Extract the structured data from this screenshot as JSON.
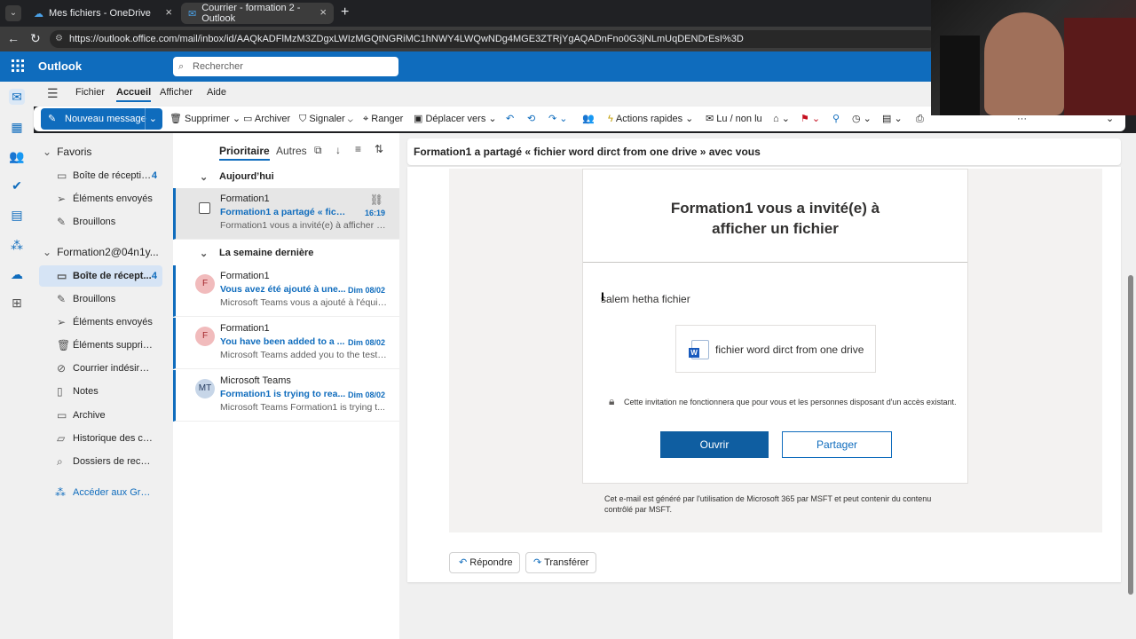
{
  "browser": {
    "tabs": [
      {
        "label": "Mes fichiers - OneDrive"
      },
      {
        "label": "Courrier - formation 2 - Outlook"
      }
    ],
    "url": "https://outlook.office.com/mail/inbox/id/AAQkADFlMzM3ZDgxLWIzMGQtNGRiMC1hNWY4LWQwNDg4MGE3ZTRjYgAQADnFno0G3jNLmUqDENDrEsI%3D"
  },
  "app": {
    "name": "Outlook",
    "search_placeholder": "Rechercher",
    "accent": "#0f6cbd"
  },
  "ribbon_tabs": [
    "Fichier",
    "Accueil",
    "Afficher",
    "Aide"
  ],
  "toolbar": {
    "new_message": "Nouveau message",
    "delete": "Supprimer",
    "archive": "Archiver",
    "report": "Signaler",
    "sweep": "Ranger",
    "move": "Déplacer vers",
    "quick_actions": "Actions rapides",
    "read_unread": "Lu / non lu"
  },
  "folders": {
    "favorites_label": "Favoris",
    "favorites": [
      {
        "label": "Boîte de réceptio...",
        "count": "4",
        "icon": "inbox-icon"
      },
      {
        "label": "Éléments envoyés",
        "icon": "send-icon"
      },
      {
        "label": "Brouillons",
        "icon": "pencil-icon"
      }
    ],
    "account_label": "Formation2@04n1y...",
    "account_items": [
      {
        "label": "Boîte de récept...",
        "count": "4",
        "icon": "inbox-icon"
      },
      {
        "label": "Brouillons",
        "icon": "pencil-icon"
      },
      {
        "label": "Éléments envoyés",
        "icon": "send-icon"
      },
      {
        "label": "Éléments supprimés",
        "icon": "trash-icon"
      },
      {
        "label": "Courrier indésirable",
        "icon": "junk-icon"
      },
      {
        "label": "Notes",
        "icon": "note-icon"
      },
      {
        "label": "Archive",
        "icon": "archive-icon"
      },
      {
        "label": "Historique des con...",
        "icon": "folder-icon"
      },
      {
        "label": "Dossiers de recher...",
        "icon": "search-folder-icon"
      }
    ],
    "groups_link": "Accéder aux Group..."
  },
  "message_list": {
    "tab_focused": "Prioritaire",
    "tab_other": "Autres",
    "group_today": "Aujourd’hui",
    "group_last_week": "La semaine dernière",
    "messages": [
      {
        "sender": "Formation1",
        "subject": "Formation1 a partagé « fichier ...",
        "preview": "Formation1 vous a invité(e) à afficher u...",
        "date": "16:19",
        "avatar": ""
      },
      {
        "sender": "Formation1",
        "subject": "Vous avez été ajouté à une...",
        "preview": "Microsoft Teams vous a ajouté à l'équip...",
        "date": "Dim 08/02",
        "avatar": "F"
      },
      {
        "sender": "Formation1",
        "subject": "You have been added to a ...",
        "preview": "Microsoft Teams added you to the test ...",
        "date": "Dim 08/02",
        "avatar": "F"
      },
      {
        "sender": "Microsoft Teams",
        "subject": "Formation1 is trying to rea...",
        "preview": "Microsoft Teams Formation1 is trying t...",
        "date": "Dim 08/02",
        "avatar": "MT"
      }
    ]
  },
  "reading": {
    "subject": "Formation1 a partagé « fichier word dirct from one drive » avec vous",
    "invite_title_line1": "Formation1 vous a invité(e) à",
    "invite_title_line2": "afficher un fichier",
    "message_text": "salem hetha fichier",
    "file_name": "fichier word dirct from one drive",
    "lock_note": "Cette invitation ne fonctionnera que pour vous et les personnes disposant d'un accès existant.",
    "open_button": "Ouvrir",
    "share_button": "Partager",
    "footer_line1": "Cet e-mail est généré par l'utilisation de Microsoft 365 par MSFT et peut contenir du contenu",
    "footer_line2": "contrôlé par MSFT.",
    "reply": "Répondre",
    "forward": "Transférer"
  }
}
